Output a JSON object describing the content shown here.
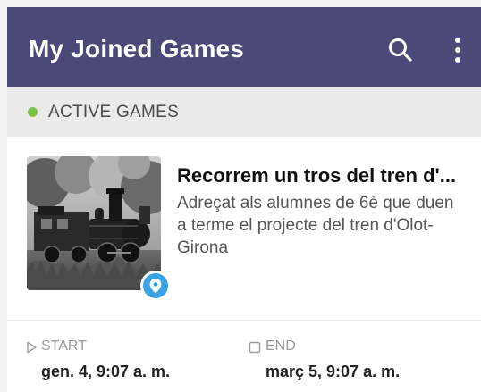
{
  "app_bar": {
    "title": "My Joined Games",
    "search_icon": "search-icon",
    "more_icon": "more-vertical-icon",
    "background_color": "#4a4a78"
  },
  "section": {
    "label": "ACTIVE GAMES",
    "status_color": "#7cc04b"
  },
  "game": {
    "title": "Recorrem un tros del tren d'...",
    "description": "Adreçat als alumnes de 6è que duen a terme el projecte del tren d'Olot-Girona",
    "thumbnail_icon": "steam-locomotive-photo",
    "badge_icon": "location-pin-icon",
    "badge_color": "#3aa3e3",
    "start_label": "START",
    "start_value": "gen. 4, 9:07 a. m.",
    "start_icon": "play-outline-icon",
    "end_label": "END",
    "end_value": "març 5, 9:07 a. m.",
    "end_icon": "stop-outline-icon"
  }
}
